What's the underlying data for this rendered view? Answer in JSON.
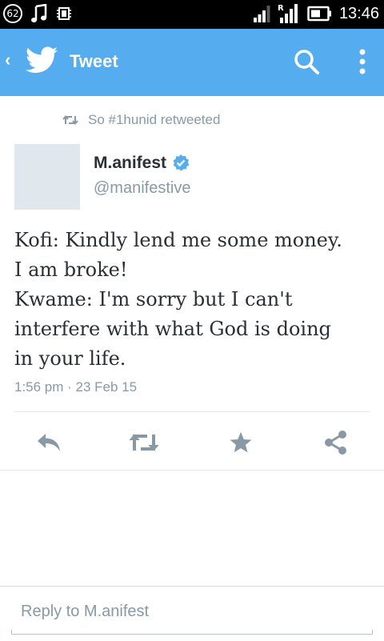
{
  "status_bar": {
    "notification_count": "62",
    "time": "13:46",
    "icons": [
      "notification-count-icon",
      "music-note-icon",
      "chip-icon",
      "signal-icon",
      "roaming-signal-icon",
      "battery-icon"
    ],
    "roaming_label": "R"
  },
  "app_bar": {
    "title": "Tweet",
    "color": "#55acee",
    "icons": [
      "back-chevron-icon",
      "twitter-bird-icon",
      "search-icon",
      "more-vert-icon"
    ]
  },
  "tweet": {
    "retweet_context": "So #1hunid retweeted",
    "author_name": "M.anifest",
    "author_handle": "@manifestive",
    "verified": true,
    "text_lines": [
      "Kofi: Kindly lend me some money.",
      "I am broke!",
      "Kwame: I'm sorry but I can't",
      "interfere with what God is doing",
      "in your life."
    ],
    "timestamp": "1:56 pm · 23 Feb 15"
  },
  "actions": [
    "reply-icon",
    "retweet-icon",
    "favorite-star-icon",
    "share-icon"
  ],
  "reply": {
    "placeholder": "Reply to M.anifest"
  }
}
